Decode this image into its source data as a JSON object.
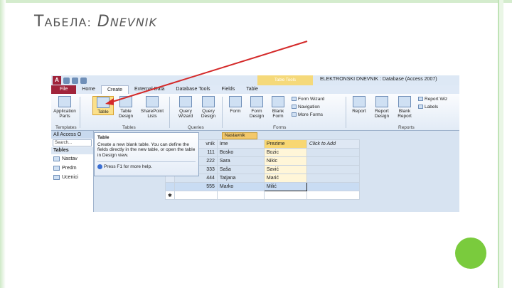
{
  "slide": {
    "title_first": "Т",
    "title_rest": "АБЕЛА:",
    "title_db_first": "D",
    "title_db_rest": "NEVNIK"
  },
  "window": {
    "title": "ELEKTRONSKI DNEVNIK : Database (Access 2007)",
    "context_tab": "Table Tools",
    "app_icon": "A"
  },
  "tabs": [
    "File",
    "Home",
    "Create",
    "External Data",
    "Database Tools",
    "Fields",
    "Table"
  ],
  "ribbon": {
    "templates": {
      "btn1": "Application",
      "btn1b": "Parts",
      "label": "Templates"
    },
    "tables": {
      "btn1": "Table",
      "btn2": "Table",
      "btn2b": "Design",
      "btn3": "SharePoint",
      "btn3b": "Lists",
      "label": "Tables"
    },
    "queries": {
      "btn1": "Query",
      "btn1b": "Wizard",
      "btn2": "Query",
      "btn2b": "Design",
      "label": "Queries"
    },
    "forms": {
      "btn1": "Form",
      "btn2": "Form",
      "btn2b": "Design",
      "btn3": "Blank",
      "btn3b": "Form",
      "item1": "Form Wizard",
      "item2": "Navigation",
      "item3": "More Forms",
      "label": "Forms"
    },
    "reports": {
      "btn1": "Report",
      "btn2": "Report",
      "btn2b": "Design",
      "btn3": "Blank",
      "btn3b": "Report",
      "item1": "Report Wiz",
      "item2": "Labels",
      "label": "Reports"
    }
  },
  "nav": {
    "header": "All Access O",
    "search": "Search...",
    "section": "Tables",
    "items": [
      "Nastav",
      "Predm",
      "Ucenici"
    ]
  },
  "tooltip": {
    "title": "Table",
    "body": "Create a new blank table. You can define the fields directly in the new table, or open the table in Design view.",
    "help": "Press F1 for more help."
  },
  "doc_tab": "Nastavnik",
  "grid": {
    "headers": [
      "vnik",
      "Ime",
      "Prezime",
      "Click to Add"
    ],
    "rows": [
      [
        "111",
        "Bosko",
        "Bozic"
      ],
      [
        "222",
        "Sara",
        "Nikic"
      ],
      [
        "333",
        "Saša",
        "Savić"
      ],
      [
        "444",
        "Tatjana",
        "Marić"
      ],
      [
        "555",
        "Marko",
        "Milić"
      ]
    ],
    "new_row_marker": "✱"
  }
}
